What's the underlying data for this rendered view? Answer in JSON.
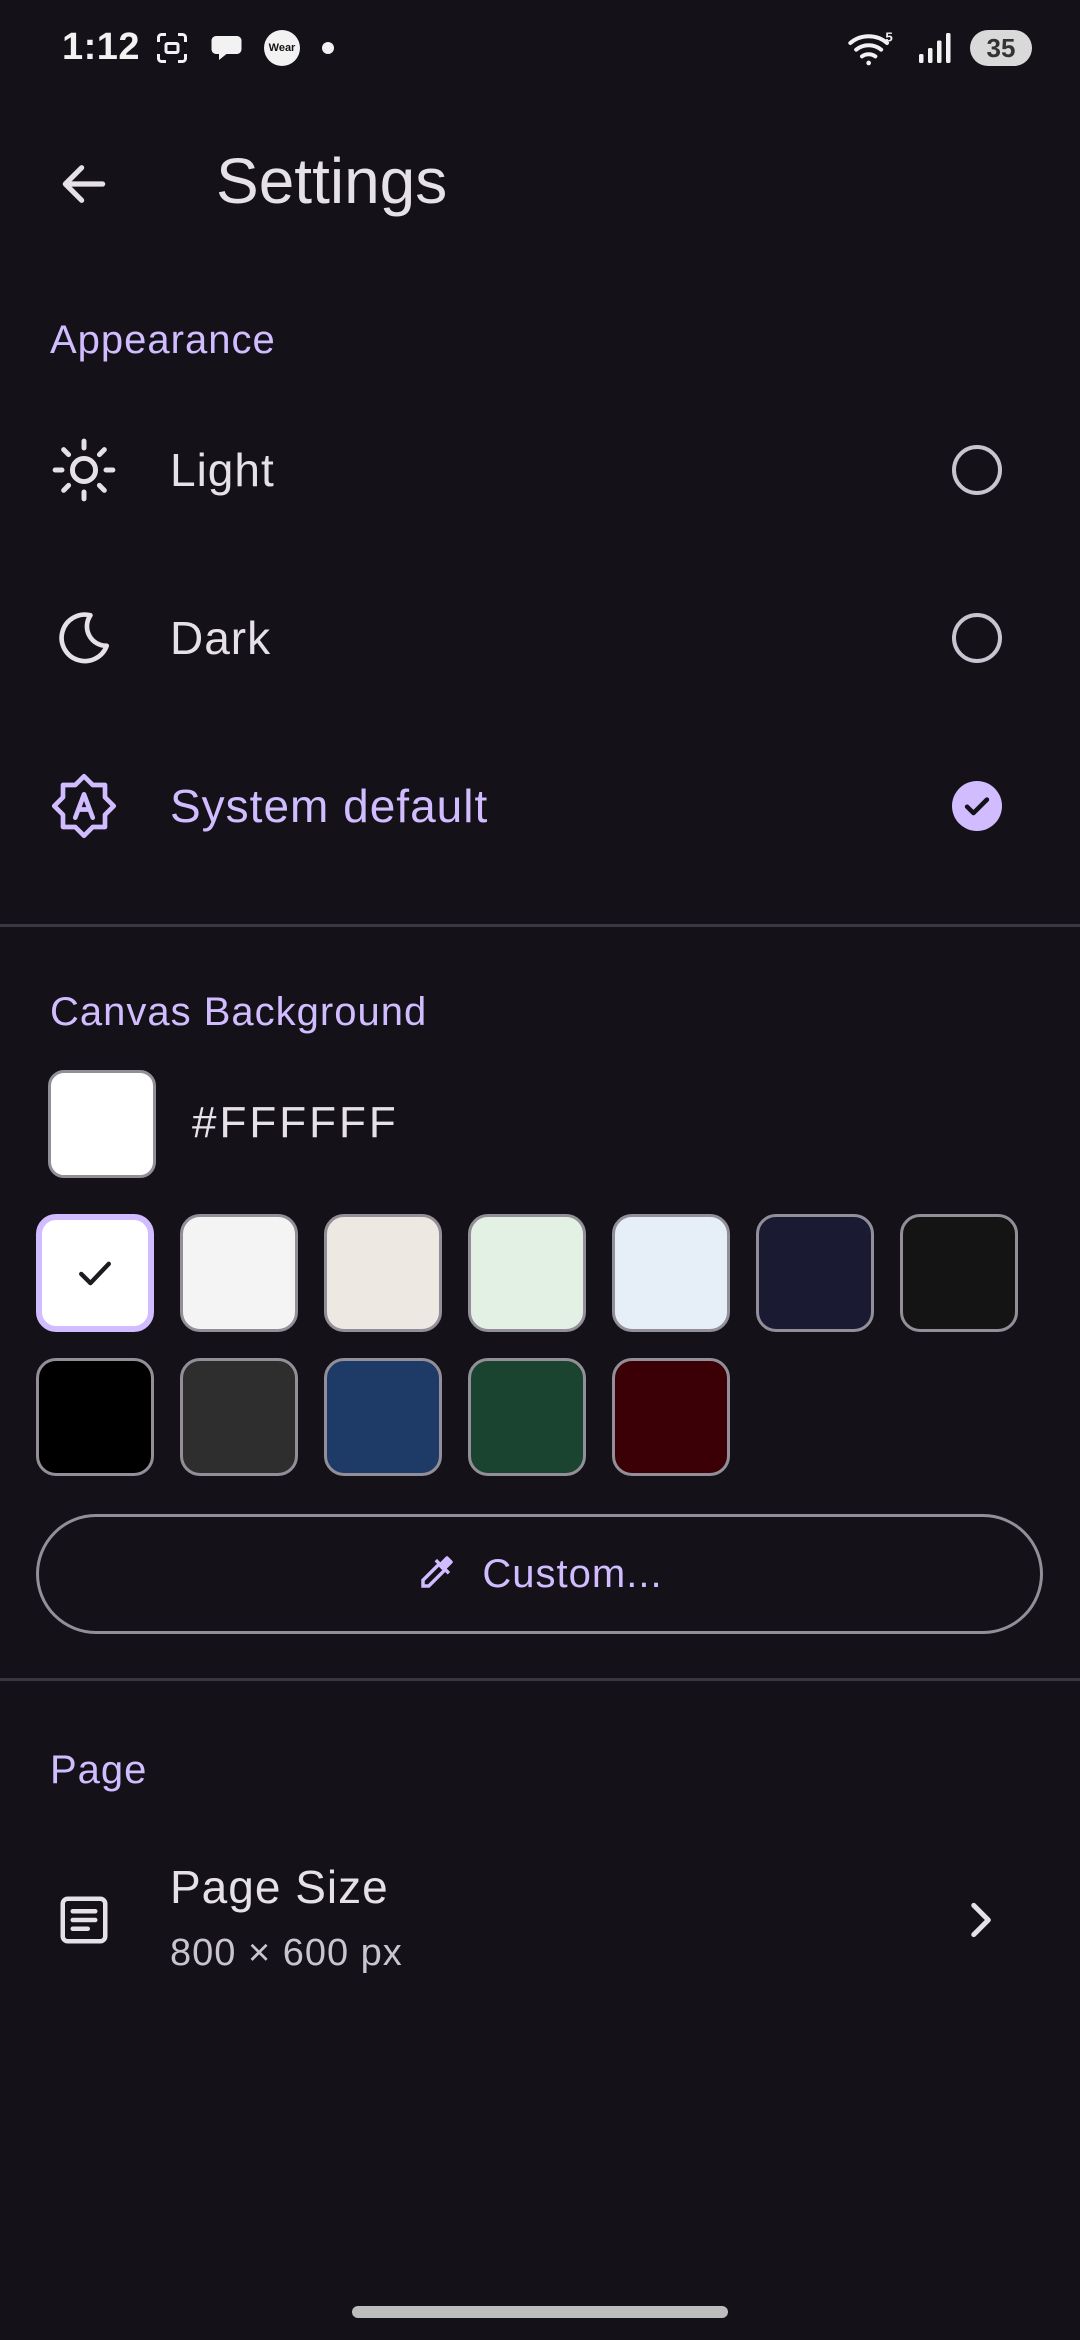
{
  "status_bar": {
    "time": "1:12",
    "wear_label": "Wear",
    "network_label": "5",
    "battery": "35"
  },
  "app_bar": {
    "title": "Settings",
    "back_icon": "arrow-back-icon"
  },
  "appearance": {
    "header": "Appearance",
    "options": [
      {
        "label": "Light",
        "icon": "sun-icon",
        "selected": false
      },
      {
        "label": "Dark",
        "icon": "moon-icon",
        "selected": false
      },
      {
        "label": "System default",
        "icon": "auto-brightness-icon",
        "selected": true
      }
    ]
  },
  "canvas_background": {
    "header": "Canvas Background",
    "current_hex": "#FFFFFF",
    "swatches": [
      {
        "color": "#FFFFFF",
        "selected": true
      },
      {
        "color": "#F4F4F4",
        "selected": false
      },
      {
        "color": "#EEE8E3",
        "selected": false
      },
      {
        "color": "#E3F1E4",
        "selected": false
      },
      {
        "color": "#E6EEF8",
        "selected": false
      },
      {
        "color": "#1A1B33",
        "selected": false
      },
      {
        "color": "#141414",
        "selected": false
      },
      {
        "color": "#000000",
        "selected": false
      },
      {
        "color": "#2E2E2E",
        "selected": false
      },
      {
        "color": "#1E3A66",
        "selected": false
      },
      {
        "color": "#1B4430",
        "selected": false
      },
      {
        "color": "#3B0006",
        "selected": false
      }
    ],
    "custom_button_label": "Custom...",
    "custom_icon": "eyedropper-icon"
  },
  "page": {
    "header": "Page",
    "page_size_title": "Page Size",
    "page_size_value": "800 × 600 px",
    "icon": "document-icon",
    "chevron_icon": "chevron-right-icon"
  },
  "theme": {
    "accent": "#D0BCFF",
    "background": "#141218"
  }
}
